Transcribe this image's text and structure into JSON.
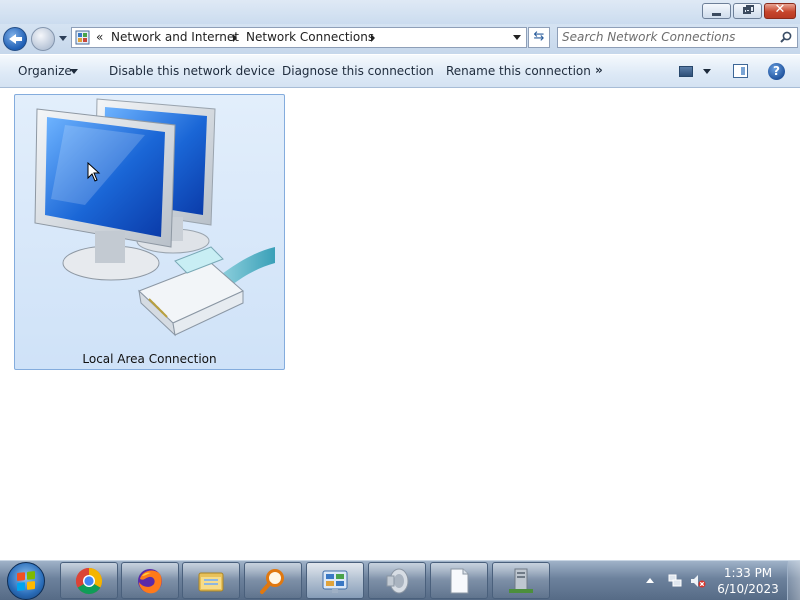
{
  "window": {
    "controls": {
      "minimize": "minimize-icon",
      "maximize": "restore-icon",
      "close": "close-icon",
      "close_glyph": "✕"
    }
  },
  "address": {
    "leading": "«",
    "crumbs": [
      "Network and Internet",
      "Network Connections"
    ],
    "refresh_glyph": "⇆"
  },
  "search": {
    "placeholder": "Search Network Connections"
  },
  "commands": {
    "organize": "Organize",
    "disable": "Disable this network device",
    "diagnose": "Diagnose this connection",
    "rename": "Rename this connection",
    "more": "»",
    "help": "?"
  },
  "content": {
    "items": [
      {
        "label": "Local Area Connection",
        "icon": "network-computers-icon",
        "selected": true
      }
    ]
  },
  "taskbar": {
    "apps": [
      "chrome-icon",
      "firefox-icon",
      "file-explorer-icon",
      "search-magnifier-icon",
      "control-panel-icon",
      "speaker-icon",
      "document-icon",
      "server-icon"
    ],
    "clock": {
      "time": "1:33 PM",
      "date": "6/10/2023"
    }
  },
  "colors": {
    "accent": "#1f5fb5",
    "selection_fill": "#cfe2f8",
    "selection_border": "#84acdd",
    "taskbar": "#6c819c"
  }
}
